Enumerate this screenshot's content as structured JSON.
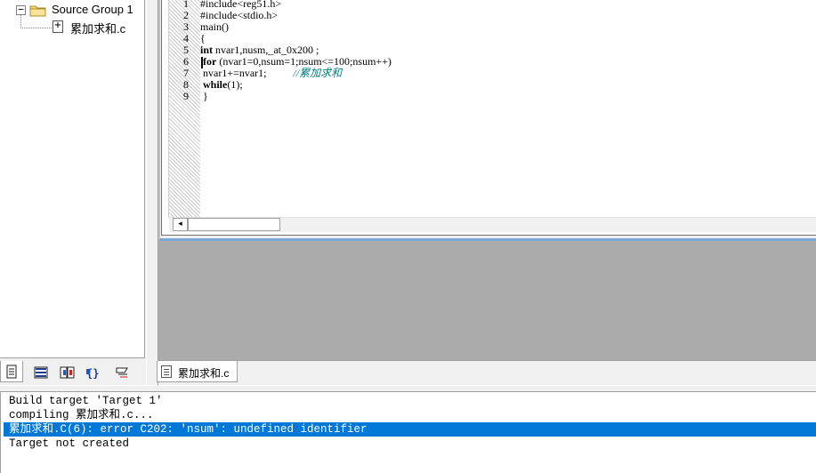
{
  "project_tree": {
    "expand_glyph": "−",
    "group_label": "Source Group 1",
    "file_label": "累加求和.c",
    "icons": [
      "folder-icon",
      "c-file-icon"
    ]
  },
  "left_tabs": [
    {
      "name": "project-tab",
      "icon": "document-icon",
      "active": true
    },
    {
      "name": "registers-tab",
      "icon": "list-icon",
      "active": false
    },
    {
      "name": "books-tab",
      "icon": "book-icon",
      "active": false
    },
    {
      "name": "functions-tab",
      "icon": "braces-icon",
      "active": false
    },
    {
      "name": "templates-tab",
      "icon": "template-icon",
      "active": false
    }
  ],
  "editor": {
    "line_numbers": [
      "1",
      "2",
      "3",
      "4",
      "5",
      "6",
      "7",
      "8",
      "9"
    ],
    "lines": [
      {
        "segments": [
          {
            "t": "#include<reg51.h>",
            "c": ""
          }
        ]
      },
      {
        "segments": [
          {
            "t": "#include<stdio.h>",
            "c": ""
          }
        ]
      },
      {
        "segments": [
          {
            "t": "main()",
            "c": ""
          }
        ]
      },
      {
        "segments": [
          {
            "t": "{",
            "c": ""
          }
        ]
      },
      {
        "segments": [
          {
            "t": "int",
            "c": "kw"
          },
          {
            "t": " nvar1,nusm,_at_0x200 ;",
            "c": ""
          }
        ]
      },
      {
        "segments": [
          {
            "t": " ",
            "c": ""
          },
          {
            "t": "for",
            "c": "kw"
          },
          {
            "t": " (nvar1=0,nsum=1;nsum<=100;nsum++)",
            "c": ""
          }
        ]
      },
      {
        "segments": [
          {
            "t": " nvar1+=nvar1;          ",
            "c": ""
          },
          {
            "t": "//累加求和",
            "c": "cmt"
          }
        ]
      },
      {
        "segments": [
          {
            "t": " ",
            "c": ""
          },
          {
            "t": "while",
            "c": "kw"
          },
          {
            "t": "(1);",
            "c": ""
          }
        ]
      },
      {
        "segments": [
          {
            "t": " }",
            "c": ""
          }
        ]
      }
    ],
    "scroll_left_glyph": "◂",
    "tab_label": "累加求和.c"
  },
  "output": {
    "lines": [
      {
        "text": "Build target 'Target 1'",
        "selected": false
      },
      {
        "text": "compiling 累加求和.c...",
        "selected": false
      },
      {
        "text": "累加求和.C(6): error C202: 'nsum': undefined identifier",
        "selected": true
      },
      {
        "text": "Target not created",
        "selected": false
      }
    ]
  },
  "colors": {
    "selection": "#0078d7",
    "comment": "#008080",
    "mdi_background": "#ababab",
    "active_frame": "#7aa7d6"
  }
}
